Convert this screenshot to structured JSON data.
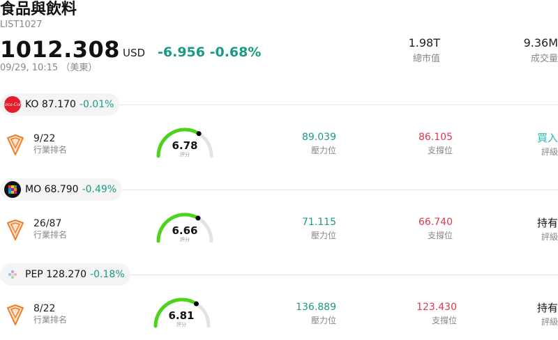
{
  "header": {
    "title": "食品與飲料",
    "code": "LIST1027",
    "price": "1012.308",
    "currency": "USD",
    "change": "-6.956 -0.68%",
    "time": "09/29, 10:15 （美東）",
    "market_cap_value": "1.98T",
    "market_cap_label": "總市值",
    "volume_value": "9.36M",
    "volume_label": "成交量"
  },
  "colors": {
    "up": "#1a9a83",
    "down": "#e0374d",
    "gauge": "#4cd31a",
    "rating_buy": "#2bb7b4"
  },
  "stocks": [
    {
      "ticker": "KO",
      "price": "87.170",
      "change": "-0.01%",
      "rank": "9/22",
      "rank_label": "行業排名",
      "score": "6.78",
      "score_label": "評分",
      "score_value": 6.78,
      "resistance": "89.039",
      "resistance_label": "壓力位",
      "support": "86.105",
      "support_label": "支撐位",
      "rating": "買入",
      "rating_label": "評級",
      "logo_icon": "coca-cola-logo-icon"
    },
    {
      "ticker": "MO",
      "price": "68.790",
      "change": "-0.49%",
      "rank": "26/87",
      "rank_label": "行業排名",
      "score": "6.66",
      "score_label": "評分",
      "score_value": 6.66,
      "resistance": "71.115",
      "resistance_label": "壓力位",
      "support": "66.740",
      "support_label": "支撐位",
      "rating": "持有",
      "rating_label": "評級",
      "logo_icon": "altria-logo-icon"
    },
    {
      "ticker": "PEP",
      "price": "128.270",
      "change": "-0.18%",
      "rank": "8/22",
      "rank_label": "行業排名",
      "score": "6.81",
      "score_label": "評分",
      "score_value": 6.81,
      "resistance": "136.889",
      "resistance_label": "壓力位",
      "support": "123.430",
      "support_label": "支撐位",
      "rating": "持有",
      "rating_label": "評級",
      "logo_icon": "pepsico-logo-icon"
    }
  ]
}
